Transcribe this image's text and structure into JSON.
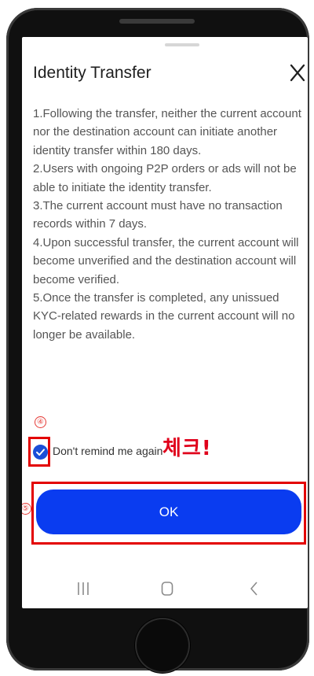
{
  "dialog": {
    "title": "Identity Transfer",
    "close_icon": "close-icon",
    "rules": [
      "1.Following the transfer, neither the current account nor the destination account can initiate another identity transfer within 180 days.",
      "2.Users with ongoing P2P orders or ads will not be able to initiate the identity transfer.",
      "3.The current account must have no transaction records within 7 days.",
      "4.Upon successful transfer, the current account will become unverified and the destination account will become verified.",
      "5.Once the transfer is completed, any unissued KYC-related rewards in the current account will no longer be available."
    ],
    "checkbox_label": "Don't remind me again",
    "checkbox_checked": true,
    "ok_label": "OK"
  },
  "annotations": {
    "step_four": "④",
    "step_five": "⑤",
    "check_note": "체크!"
  },
  "navbar": {
    "recents_icon": "recents-icon",
    "home_icon": "home-icon",
    "back_icon": "back-icon"
  },
  "colors": {
    "primary": "#0a3cf0",
    "checkbox": "#1a4ed8",
    "annotation_red": "#e30000",
    "body_text": "#555555"
  }
}
